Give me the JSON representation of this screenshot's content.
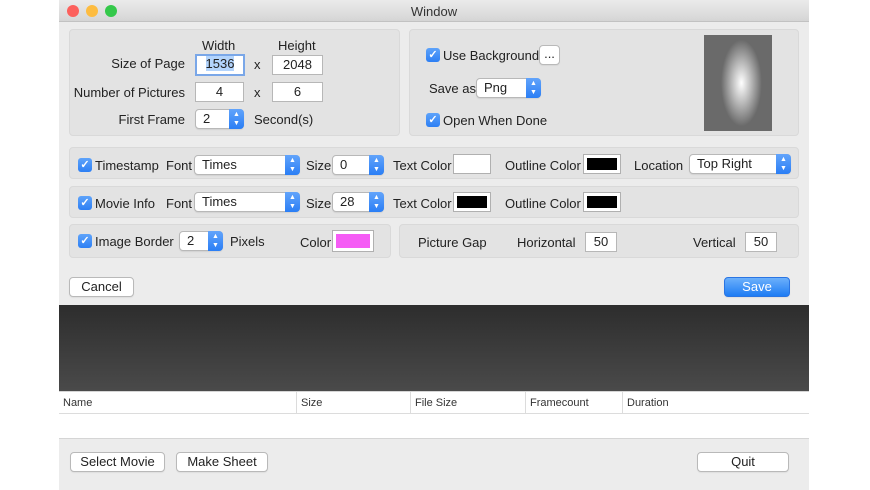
{
  "window": {
    "title": "Window",
    "traffic_lights": {
      "close": "#fc605c",
      "minimize": "#fdbc40",
      "zoom": "#34c84a"
    }
  },
  "page": {
    "width_label": "Width",
    "height_label": "Height",
    "size_of_page_label": "Size of Page",
    "width_value": "1536",
    "height_value": "2048",
    "times_symbol": "x",
    "number_of_pictures_label": "Number of Pictures",
    "pictures_cols": "4",
    "pictures_rows": "6",
    "first_frame_label": "First Frame",
    "first_frame_value": "2",
    "seconds_label": "Second(s)"
  },
  "background": {
    "use_background_label": "Use Background",
    "browse_label": "...",
    "save_as_label": "Save as",
    "format_value": "Png",
    "open_when_done_label": "Open When Done"
  },
  "timestamp": {
    "label": "Timestamp",
    "font_label": "Font",
    "font_value": "Times",
    "size_label": "Size",
    "size_value": "0",
    "text_color_label": "Text Color",
    "text_color": "#ffffff",
    "outline_color_label": "Outline Color",
    "outline_color": "#000000",
    "location_label": "Location",
    "location_value": "Top Right"
  },
  "movie_info": {
    "label": "Movie Info",
    "font_label": "Font",
    "font_value": "Times",
    "size_label": "Size",
    "size_value": "28",
    "text_color_label": "Text Color",
    "text_color": "#000000",
    "outline_color_label": "Outline Color",
    "outline_color": "#000000"
  },
  "border": {
    "label": "Image Border",
    "pixels_value": "2",
    "pixels_label": "Pixels",
    "color_label": "Color",
    "color": "#f55cf5"
  },
  "gap": {
    "label": "Picture Gap",
    "horizontal_label": "Horizontal",
    "horizontal_value": "50",
    "vertical_label": "Vertical",
    "vertical_value": "50"
  },
  "buttons": {
    "cancel": "Cancel",
    "save": "Save",
    "select_movie": "Select Movie",
    "make_sheet": "Make Sheet",
    "quit": "Quit"
  },
  "table": {
    "columns": [
      "Name",
      "Size",
      "File Size",
      "Framecount",
      "Duration"
    ]
  },
  "colors": {
    "accent": "#2b80f5",
    "window_bg": "#ececec"
  }
}
